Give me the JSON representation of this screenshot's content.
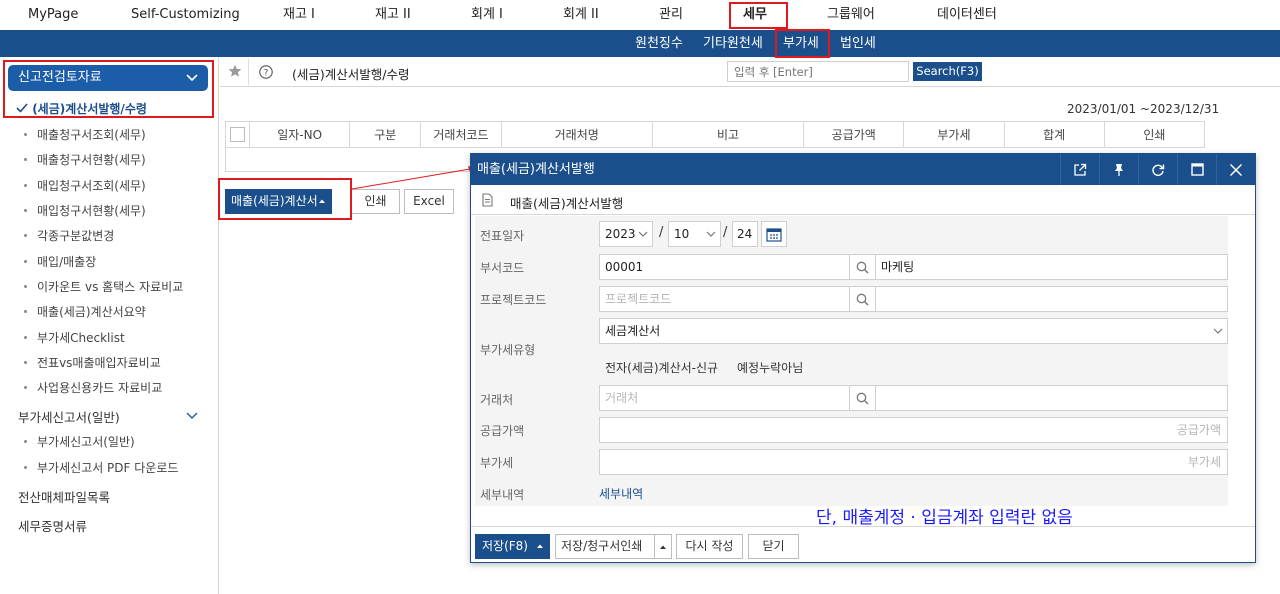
{
  "topnav": {
    "items": [
      "MyPage",
      "Self-Customizing",
      "재고 I",
      "재고 II",
      "회계 I",
      "회계 II",
      "관리",
      "세무",
      "그룹웨어",
      "데이터센터"
    ]
  },
  "subnav": {
    "items": [
      "원천징수",
      "기타원천세",
      "부가세",
      "법인세"
    ]
  },
  "sidebar": {
    "section_title": "신고전검토자료",
    "items": [
      "(세금)계산서발행/수령",
      "매출청구서조회(세무)",
      "매출청구서현황(세무)",
      "매입청구서조회(세무)",
      "매입청구서현황(세무)",
      "각종구분값변경",
      "매입/매출장",
      "이카운트 vs 홈택스 자료비교",
      "매출(세금)계산서요약",
      "부가세Checklist",
      "전표vs매출매입자료비교",
      "사업용신용카드 자료비교"
    ],
    "group2_title": "부가세신고서(일반)",
    "group2_items": [
      "부가세신고서(일반)",
      "부가세신고서 PDF 다운로드"
    ],
    "group3_title": "전산매체파일목록",
    "group4_title": "세무증명서류"
  },
  "main": {
    "page_title": "(세금)계산서발행/수령",
    "search_placeholder": "입력 후 [Enter]",
    "search_button": "Search(F3)",
    "date_range": "2023/01/01 ~2023/12/31",
    "columns": [
      "일자-NO",
      "구분",
      "거래처코드",
      "거래처명",
      "비고",
      "공급가액",
      "부가세",
      "합계",
      "인쇄"
    ],
    "btn_issue": "매출(세금)계산서",
    "btn_print": "인쇄",
    "btn_excel": "Excel"
  },
  "modal": {
    "title": "매출(세금)계산서발행",
    "subtitle": "매출(세금)계산서발행",
    "fields": {
      "date_label": "전표일자",
      "year": "2023",
      "month": "10",
      "day": "24",
      "slash": "/",
      "dept_label": "부서코드",
      "dept_code": "00001",
      "dept_name": "마케팅",
      "project_label": "프로젝트코드",
      "project_placeholder": "프로젝트코드",
      "vat_type_label": "부가세유형",
      "vat_type_value": "세금계산서",
      "vat_tag1": "전자(세금)계산서-신규",
      "vat_tag2": "예정누락아님",
      "customer_label": "거래처",
      "customer_placeholder": "거래처",
      "supply_label": "공급가액",
      "supply_placeholder": "공급가액",
      "vat_label": "부가세",
      "vat_placeholder": "부가세",
      "detail_label": "세부내역",
      "detail_link": "세부내역"
    },
    "footer": {
      "save": "저장(F8)",
      "save_print": "저장/청구서인쇄",
      "rewrite": "다시 작성",
      "close": "닫기"
    }
  },
  "annotation": "단, 매출계정 · 입금계좌 입력란 없음",
  "colors": {
    "brand_blue": "#1b4f8c",
    "highlight_red": "#e0191f",
    "note_blue": "#1a1aff"
  }
}
